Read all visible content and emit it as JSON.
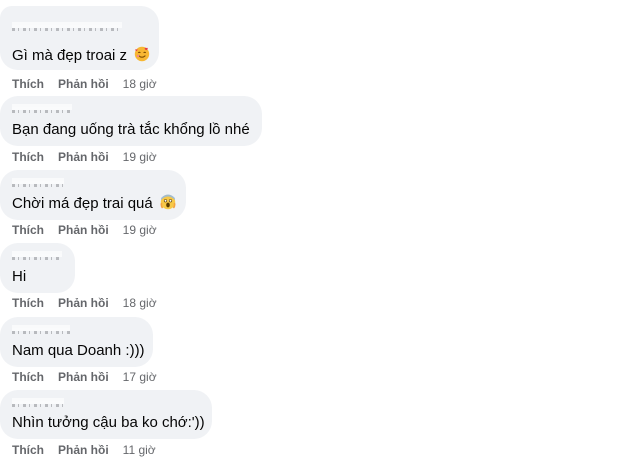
{
  "comments": [
    {
      "text": "Gì mà đẹp troai z",
      "emoji": "smiling-face-with-hearts-icon",
      "like": "Thích",
      "reply": "Phản hồi",
      "time": "18 giờ"
    },
    {
      "text": "Bạn đang uống trà tắc khổng lồ nhé",
      "emoji": "",
      "like": "Thích",
      "reply": "Phản hồi",
      "time": "19 giờ"
    },
    {
      "text": "Chời má đẹp trai quá",
      "emoji": "face-screaming-icon",
      "like": "Thích",
      "reply": "Phản hồi",
      "time": "19 giờ"
    },
    {
      "text": "Hi",
      "emoji": "",
      "like": "Thích",
      "reply": "Phản hồi",
      "time": "18 giờ"
    },
    {
      "text": "Nam qua Doanh :)))",
      "emoji": "",
      "like": "Thích",
      "reply": "Phản hồi",
      "time": "17 giờ"
    },
    {
      "text": "Nhìn tưởng cậu ba ko chớ:'))",
      "emoji": "",
      "like": "Thích",
      "reply": "Phản hồi",
      "time": "11 giờ"
    }
  ],
  "colors": {
    "bubble": "#f0f2f5",
    "text": "#050505",
    "meta": "#65676b"
  }
}
